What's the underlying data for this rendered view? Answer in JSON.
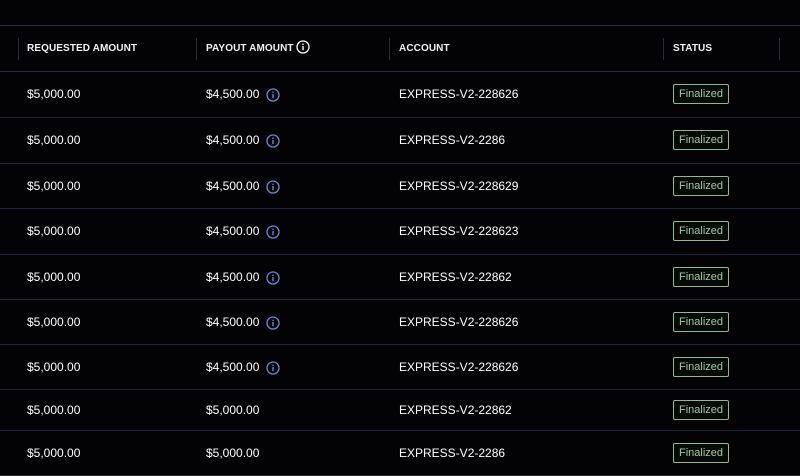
{
  "header": {
    "requested_amount": "REQUESTED AMOUNT",
    "payout_amount": "PAYOUT AMOUNT",
    "account": "ACCOUNT",
    "status": "STATUS"
  },
  "rows": [
    {
      "requested": "$5,000.00",
      "payout": "$4,500.00",
      "has_info": true,
      "account": "EXPRESS-V2-228626",
      "status": "Finalized"
    },
    {
      "requested": "$5,000.00",
      "payout": "$4,500.00",
      "has_info": true,
      "account": "EXPRESS-V2-2286",
      "status": "Finalized"
    },
    {
      "requested": "$5,000.00",
      "payout": "$4,500.00",
      "has_info": true,
      "account": "EXPRESS-V2-228629",
      "status": "Finalized"
    },
    {
      "requested": "$5,000.00",
      "payout": "$4,500.00",
      "has_info": true,
      "account": "EXPRESS-V2-228623",
      "status": "Finalized"
    },
    {
      "requested": "$5,000.00",
      "payout": "$4,500.00",
      "has_info": true,
      "account": "EXPRESS-V2-22862",
      "status": "Finalized"
    },
    {
      "requested": "$5,000.00",
      "payout": "$4,500.00",
      "has_info": true,
      "account": "EXPRESS-V2-228626",
      "status": "Finalized"
    },
    {
      "requested": "$5,000.00",
      "payout": "$4,500.00",
      "has_info": true,
      "account": "EXPRESS-V2-228626",
      "status": "Finalized"
    },
    {
      "requested": "$5,000.00",
      "payout": "$5,000.00",
      "has_info": false,
      "account": "EXPRESS-V2-22862",
      "status": "Finalized"
    },
    {
      "requested": "$5,000.00",
      "payout": "$5,000.00",
      "has_info": false,
      "account": "EXPRESS-V2-2286",
      "status": "Finalized"
    }
  ],
  "colors": {
    "background": "#030306",
    "info_icon": "#6f86d6",
    "badge_border": "#8fb89a",
    "badge_text": "#9ccaa5"
  },
  "icons": {
    "header_info": "info-circle-icon",
    "row_info": "info-circle-icon"
  }
}
